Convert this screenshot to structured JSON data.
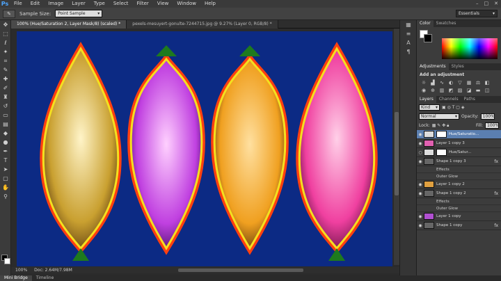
{
  "app": {
    "logo": "Ps"
  },
  "menu": [
    "File",
    "Edit",
    "Image",
    "Layer",
    "Type",
    "Select",
    "Filter",
    "View",
    "Window",
    "Help"
  ],
  "window_controls": [
    "–",
    "□",
    "✕"
  ],
  "options": {
    "sample_size_label": "Sample Size:",
    "sample_size_value": "Point Sample",
    "workspace": "Essentials"
  },
  "tabs": [
    {
      "label": "100% (Hue/Saturation 2, Layer Mask/8) (scaled) *",
      "active": true
    },
    {
      "label": "pexels-mesuyert-gonulte-7244715.jpg @ 9.27% (Layer 0, RGB/8) *",
      "active": false
    }
  ],
  "status": {
    "zoom": "100%",
    "doc": "Doc: 2.64M/7.98M"
  },
  "bottom_tabs": [
    "Mini Bridge",
    "Timeline"
  ],
  "panels": {
    "color_tabs": [
      "Color",
      "Swatches"
    ],
    "adjust_tabs": [
      "Adjustments",
      "Styles"
    ],
    "adjust_title": "Add an adjustment",
    "layer_tabs": [
      "Layers",
      "Channels",
      "Paths"
    ],
    "kind": "Kind",
    "blend_mode": "Normal",
    "opacity_label": "Opacity:",
    "opacity": "100%",
    "lock_label": "Lock:",
    "fill_label": "Fill:",
    "fill": "100%",
    "layers": [
      {
        "name": "Hue/Saturatio...",
        "type": "adj",
        "selected": true
      },
      {
        "name": "Layer 1 copy 3",
        "type": "img",
        "selected": false
      },
      {
        "name": "Hue/Satur...",
        "type": "adj",
        "selected": false
      },
      {
        "name": "Shape 1 copy 3",
        "type": "shape",
        "selected": false,
        "fx": true
      },
      {
        "name": "Effects",
        "type": "sub"
      },
      {
        "name": "Outer Glow",
        "type": "sub"
      },
      {
        "name": "Layer 1 copy 2",
        "type": "img",
        "selected": false
      },
      {
        "name": "Shape 1 copy 2",
        "type": "shape",
        "selected": false,
        "fx": true
      },
      {
        "name": "Effects",
        "type": "sub"
      },
      {
        "name": "Outer Glow",
        "type": "sub"
      },
      {
        "name": "Layer 1 copy",
        "type": "img",
        "selected": false
      },
      {
        "name": "Shape 1 copy",
        "type": "shape",
        "selected": false,
        "fx": true
      }
    ]
  },
  "colors": {
    "canvas_bg": "#0c2a84",
    "selection": "#5b7fb0"
  }
}
